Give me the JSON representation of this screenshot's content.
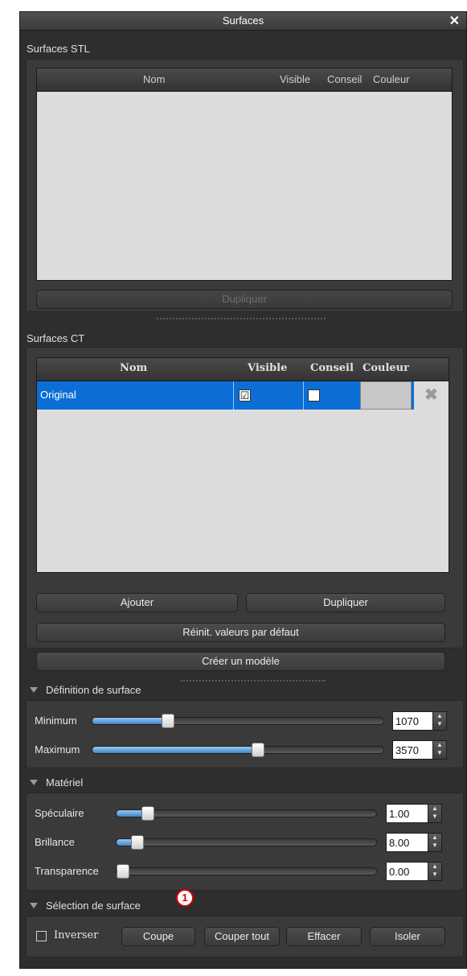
{
  "window": {
    "title": "Surfaces",
    "close_glyph": "✕"
  },
  "stl": {
    "section_label": "Surfaces STL",
    "columns": {
      "name": "Nom",
      "visible": "Visible",
      "advice": "Conseil",
      "color": "Couleur"
    },
    "duplicate_label": "Dupliquer"
  },
  "ct": {
    "section_label": "Surfaces CT",
    "columns": {
      "name": "Nom",
      "visible": "Visible",
      "advice": "Conseil",
      "color": "Couleur"
    },
    "rows": [
      {
        "name": "Original",
        "visible_checked": "☑",
        "advice_checked": "",
        "color": "#c8c8c8",
        "delete_glyph": "✖"
      }
    ],
    "add_label": "Ajouter",
    "duplicate_label": "Dupliquer",
    "reset_label": "Réinit. valeurs par défaut",
    "create_model_label": "Créer un modèle",
    "selected_row_color": "#0a6ed6"
  },
  "surface_definition": {
    "header": "Définition de surface",
    "minimum": {
      "label": "Minimum",
      "value": "1070",
      "fraction": 0.26
    },
    "maximum": {
      "label": "Maximum",
      "value": "3570",
      "fraction": 0.57
    }
  },
  "material": {
    "header": "Matériel",
    "specular": {
      "label": "Spéculaire",
      "value": "1.00",
      "fraction": 0.12
    },
    "shininess": {
      "label": "Brillance",
      "value": "8.00",
      "fraction": 0.08
    },
    "transparency": {
      "label": "Transparence",
      "value": "0.00",
      "fraction": 0.0
    }
  },
  "surface_selection": {
    "header": "Sélection de surface",
    "invert_label": "Inverser",
    "cut_label": "Coupe",
    "cut_all_label": "Couper tout",
    "erase_label": "Effacer",
    "isolate_label": "Isoler"
  },
  "annotation": {
    "number": "1",
    "color": "#d40000"
  }
}
